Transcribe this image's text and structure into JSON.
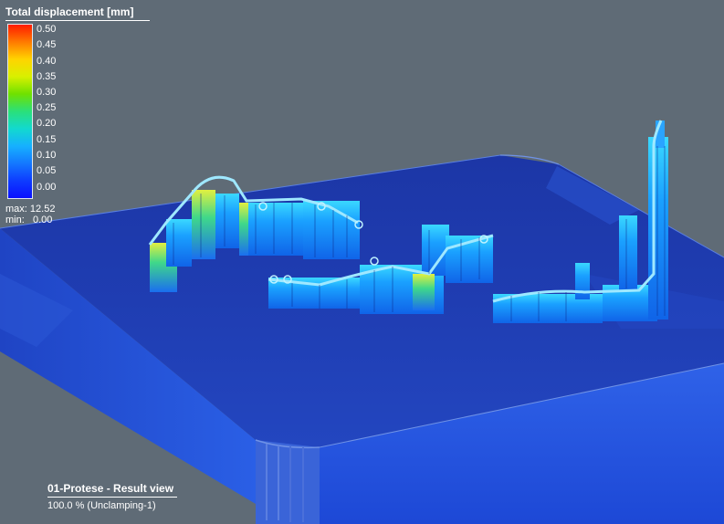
{
  "legend": {
    "title": "Total displacement [mm]",
    "ticks": [
      "0.50",
      "0.45",
      "0.40",
      "0.35",
      "0.30",
      "0.25",
      "0.20",
      "0.15",
      "0.10",
      "0.05",
      "0.00"
    ],
    "max_label": "max:",
    "max_value": "12.52",
    "min_label": "min:",
    "min_value": "0.00"
  },
  "caption": {
    "title": "01-Protese - Result view",
    "subtitle": "100.0 % (Unclamping-1)"
  },
  "colors": {
    "background": "#5f6b76",
    "plate_top": "#1f3eb0",
    "plate_edge": "#1450e6",
    "scale_max": "#ff1a00",
    "scale_min": "#0a10ff"
  }
}
